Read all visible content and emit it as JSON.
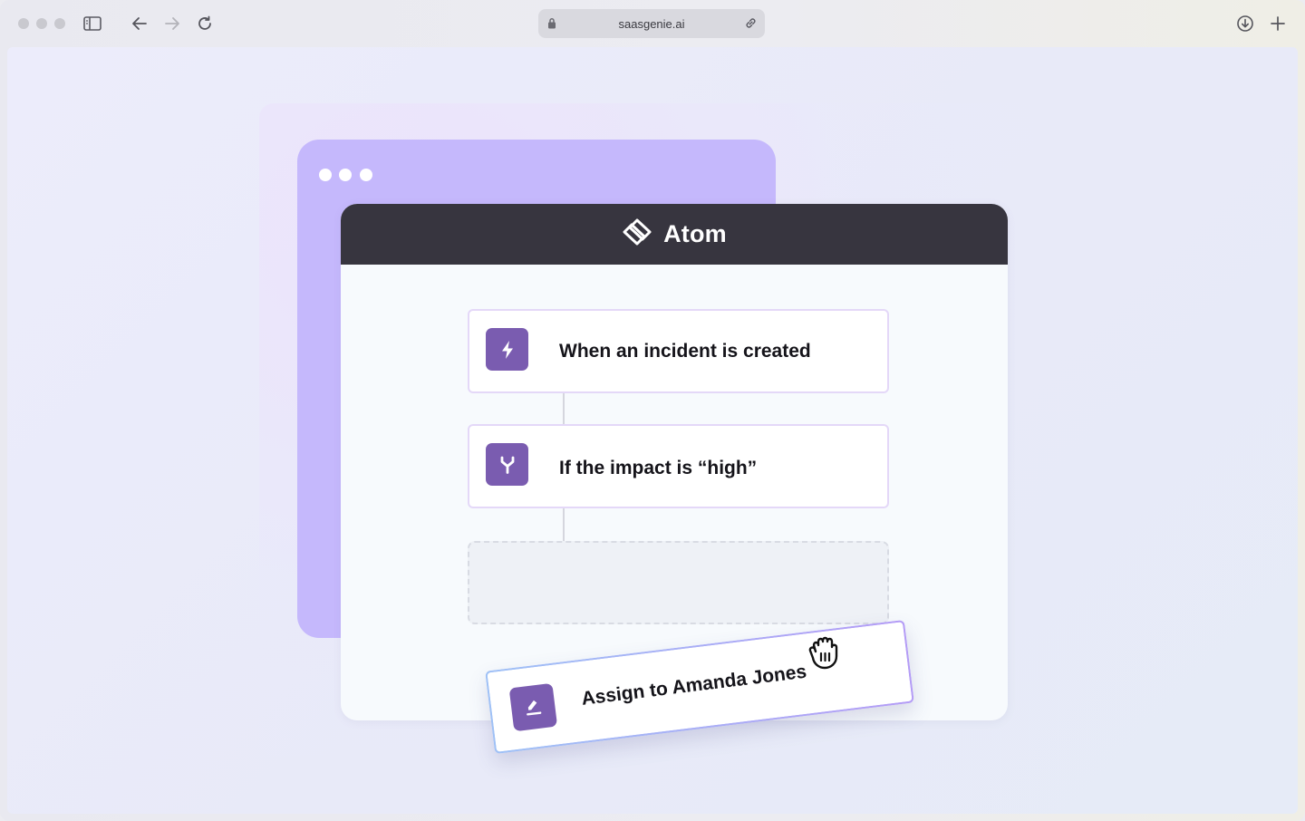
{
  "browser": {
    "url": "saasgenie.ai"
  },
  "app": {
    "brand_name": "Atom"
  },
  "workflow": {
    "steps": [
      {
        "label": "When an incident is created",
        "icon": "lightning-bolt-icon"
      },
      {
        "label": "If the impact is “high”",
        "icon": "branch-split-icon"
      }
    ],
    "dragging_step": {
      "label": "Assign to Amanda Jones",
      "icon": "pencil-edit-icon"
    }
  },
  "colors": {
    "accent_purple": "#7a5cb0",
    "back_window": "#c5b8fc",
    "header_dark": "#37353f"
  }
}
